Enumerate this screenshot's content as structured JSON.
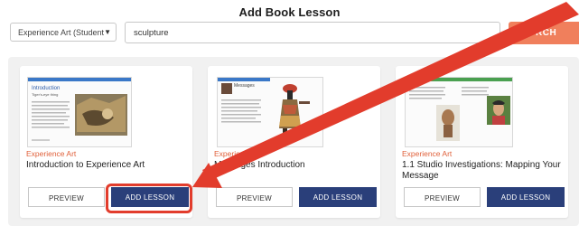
{
  "page": {
    "title": "Add Book Lesson"
  },
  "filter": {
    "selected": "Experience Art (Student"
  },
  "search": {
    "value": "sculpture",
    "button_label": "SEARCH",
    "button_visible_text": "RCH"
  },
  "cards": [
    {
      "tag": "Experience Art",
      "title": "Introduction to Experience Art",
      "thumb_heading": "Introduction",
      "thumb_sub": "Tiger's-eye thing",
      "preview_label": "PREVIEW",
      "add_label": "ADD LESSON"
    },
    {
      "tag": "Experience Art",
      "title": "Messages Introduction",
      "thumb_heading": "Messages",
      "thumb_sub": "",
      "preview_label": "PREVIEW",
      "add_label": "ADD LESSON"
    },
    {
      "tag": "Experience Art",
      "title": "1.1 Studio Investigations: Mapping Your Message",
      "thumb_heading": "",
      "thumb_sub": "",
      "preview_label": "PREVIEW",
      "add_label": "ADD LESSON"
    }
  ],
  "colors": {
    "accent_orange": "#f07f5c",
    "tag_orange": "#e0603a",
    "add_blue": "#2a3f7a",
    "highlight_red": "#e23c2c"
  },
  "annotation": {
    "highlighted": "card-1-add-lesson-button"
  }
}
